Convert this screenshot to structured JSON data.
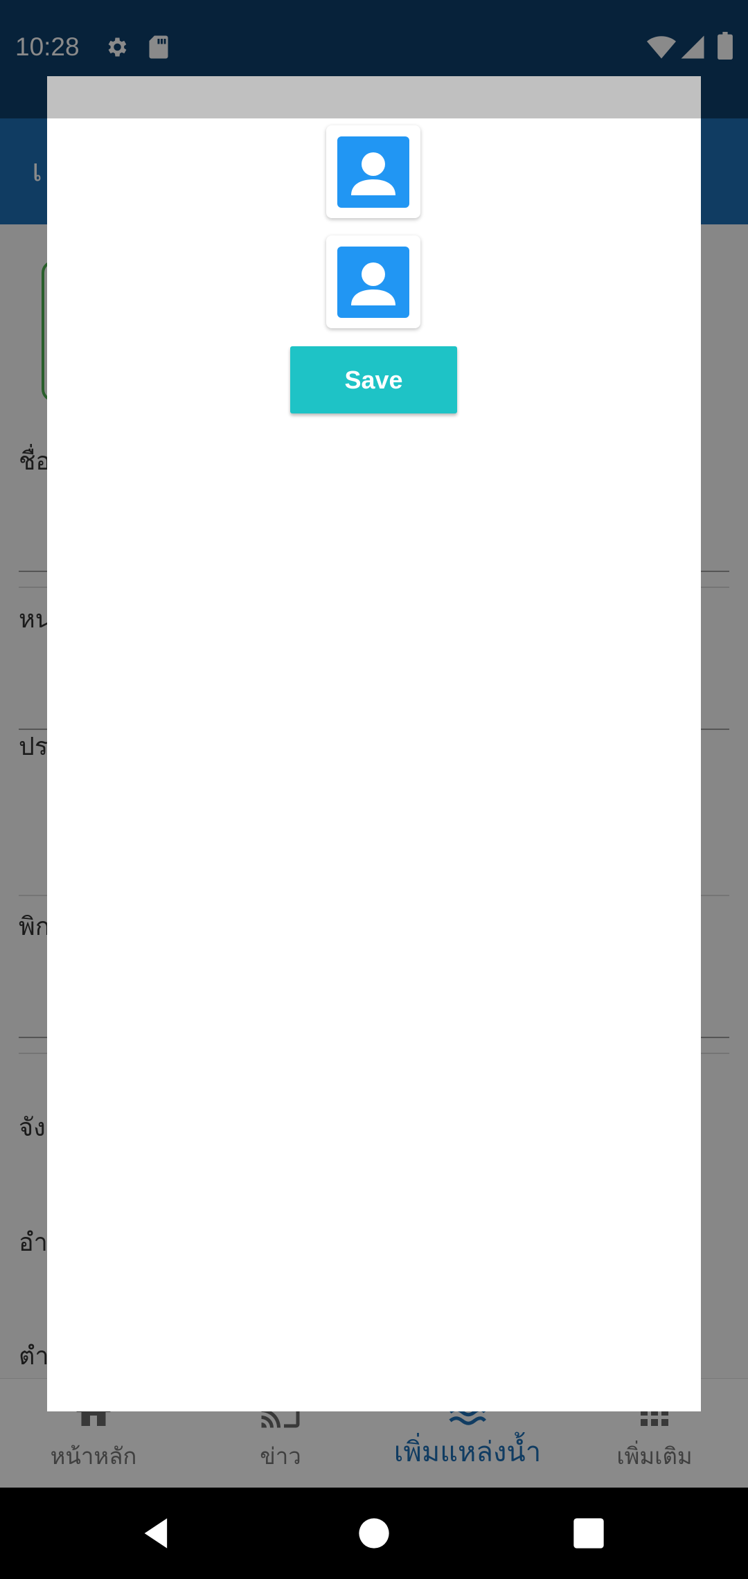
{
  "status_bar": {
    "time": "10:28",
    "icons": [
      "gear-icon",
      "sd-card-icon",
      "wifi-icon",
      "signal-icon",
      "battery-icon"
    ]
  },
  "app_bar": {
    "title": "เ"
  },
  "form": {
    "labels": [
      "ชื่อ",
      "หน",
      "ปร",
      "พิก",
      "จัง",
      "อำ",
      "ตำ"
    ]
  },
  "dialog": {
    "avatars": [
      "person-icon",
      "person-icon"
    ],
    "save_label": "Save"
  },
  "bottom_nav": {
    "items": [
      {
        "label": "หน้าหลัก",
        "icon": "home-icon"
      },
      {
        "label": "ข่าว",
        "icon": "cast-icon"
      },
      {
        "label": "เพิ่มแหล่งน้ำ",
        "icon": "water-icon"
      },
      {
        "label": "เพิ่มเติม",
        "icon": "grid-icon"
      }
    ],
    "active_index": 2
  },
  "system_nav": {
    "buttons": [
      "back-icon",
      "home-circle-icon",
      "recents-icon"
    ]
  },
  "colors": {
    "status_bar": "#0e3f6b",
    "app_bar": "#1e6fb5",
    "avatar_tile": "#2196f3",
    "save_button": "#1ec3c6",
    "dialog_header": "#c0c0c0",
    "active_nav": "#1e6fb5"
  }
}
